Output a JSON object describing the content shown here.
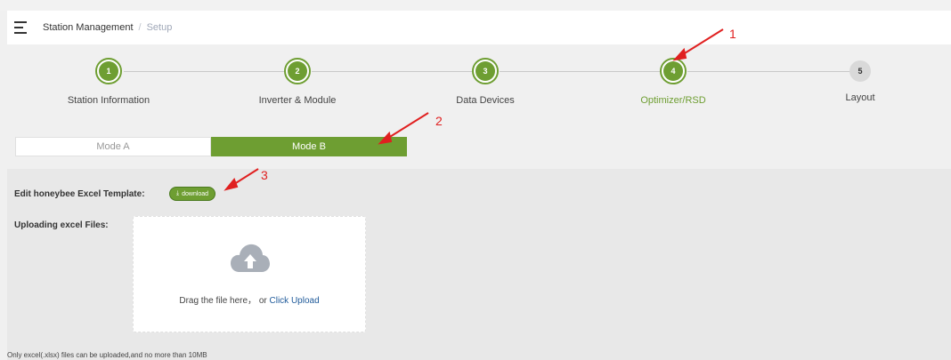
{
  "breadcrumb": {
    "root": "Station Management",
    "separator": "/",
    "current": "Setup"
  },
  "steps": [
    {
      "number": "1",
      "label": "Station Information",
      "state": "done"
    },
    {
      "number": "2",
      "label": "Inverter & Module",
      "state": "done"
    },
    {
      "number": "3",
      "label": "Data Devices",
      "state": "done"
    },
    {
      "number": "4",
      "label": "Optimizer/RSD",
      "state": "active"
    },
    {
      "number": "5",
      "label": "Layout",
      "state": "todo"
    }
  ],
  "mode_tabs": [
    {
      "label": "Mode A",
      "selected": false
    },
    {
      "label": "Mode B",
      "selected": true
    }
  ],
  "template": {
    "label": "Edit honeybee Excel Template:",
    "download_label": "download",
    "download_icon": "download-icon"
  },
  "upload": {
    "label": "Uploading excel Files:",
    "drag_text": "Drag the file here， or ",
    "click_text": "Click Upload",
    "icon": "cloud-upload-icon"
  },
  "hint": "Only excel(.xlsx) files can be uploaded,and no more than 10MB",
  "annotations": [
    "1",
    "2",
    "3"
  ],
  "colors": {
    "accent": "#6e9e32",
    "annotation": "#e02020",
    "link": "#1f5a9a"
  }
}
